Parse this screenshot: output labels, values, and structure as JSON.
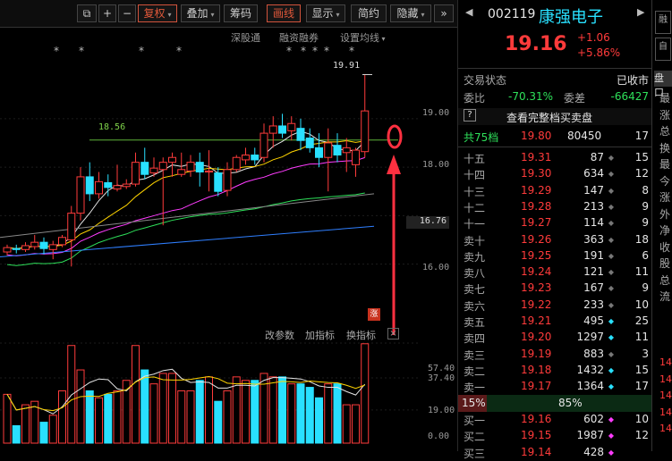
{
  "toolbar": {
    "restore_icon": "restore-window-icon",
    "zoom_in": "+",
    "zoom_out": "−",
    "adjust": "复权",
    "overlay": "叠加",
    "chips": "筹码",
    "draw": "画线",
    "display": "显示",
    "simple": "简约",
    "hide": "隐藏",
    "more": "»"
  },
  "subbar": {
    "hk": "深股通",
    "margin": "融资融券",
    "ma": "设置均线"
  },
  "chart": {
    "high_label": "19.91",
    "ref_label": "18.56",
    "prices": [
      "19.00",
      "18.00",
      "16.76",
      "16.00"
    ],
    "vol_labels": [
      "57.40",
      "37.40",
      "19.00",
      "0.00"
    ],
    "zhang_badge": "涨",
    "tabs": [
      "改参数",
      "加指标",
      "换指标"
    ],
    "close_tab": "×"
  },
  "chart_data": {
    "type": "candlestick",
    "ylim": [
      15.55,
      20.25
    ],
    "ma_colors": [
      "#e6e6e6",
      "#ffd400",
      "#ff3cff",
      "#2ee05a"
    ],
    "candles": [
      [
        16.25,
        16.4,
        16.18,
        16.34
      ],
      [
        16.32,
        16.4,
        16.22,
        16.3
      ],
      [
        16.3,
        16.45,
        16.25,
        16.38
      ],
      [
        16.36,
        16.6,
        16.3,
        16.45
      ],
      [
        16.45,
        16.55,
        16.2,
        16.32
      ],
      [
        16.3,
        16.48,
        16.1,
        16.4
      ],
      [
        16.4,
        16.6,
        16.35,
        16.55
      ],
      [
        16.5,
        17.2,
        15.95,
        17.05
      ],
      [
        17.05,
        18.0,
        16.9,
        17.8
      ],
      [
        17.8,
        18.1,
        17.3,
        17.45
      ],
      [
        17.45,
        17.9,
        17.35,
        17.7
      ],
      [
        17.68,
        17.85,
        17.4,
        17.58
      ],
      [
        17.55,
        18.05,
        17.5,
        17.62
      ],
      [
        17.6,
        17.75,
        17.55,
        17.65
      ],
      [
        17.65,
        18.3,
        17.6,
        18.1
      ],
      [
        18.1,
        18.4,
        17.75,
        17.85
      ],
      [
        17.88,
        18.2,
        17.8,
        17.98
      ],
      [
        17.95,
        18.2,
        16.8,
        18.1
      ],
      [
        18.1,
        18.3,
        17.8,
        18.2
      ],
      [
        17.85,
        18.3,
        17.8,
        17.95
      ],
      [
        17.92,
        18.25,
        17.8,
        18.1
      ],
      [
        18.1,
        18.3,
        17.6,
        17.9
      ],
      [
        17.9,
        18.35,
        17.5,
        17.92
      ],
      [
        17.88,
        18.0,
        17.4,
        17.5
      ],
      [
        17.52,
        18.1,
        17.4,
        17.95
      ],
      [
        17.95,
        18.25,
        17.9,
        18.2
      ],
      [
        18.15,
        18.4,
        18.05,
        18.25
      ],
      [
        18.25,
        18.4,
        18.05,
        18.15
      ],
      [
        18.2,
        18.9,
        18.1,
        18.7
      ],
      [
        18.7,
        19.05,
        18.4,
        18.85
      ],
      [
        18.85,
        19.1,
        18.6,
        18.7
      ],
      [
        18.75,
        19.05,
        18.55,
        18.9
      ],
      [
        18.8,
        19.0,
        18.35,
        18.55
      ],
      [
        18.6,
        18.8,
        18.3,
        18.4
      ],
      [
        18.4,
        18.7,
        18.0,
        18.2
      ],
      [
        18.2,
        18.8,
        17.5,
        18.5
      ],
      [
        18.45,
        18.7,
        18.1,
        18.25
      ],
      [
        18.3,
        18.6,
        17.9,
        18.4
      ],
      [
        18.05,
        18.4,
        17.8,
        18.35
      ],
      [
        18.32,
        19.91,
        18.2,
        19.16
      ]
    ],
    "volumes": [
      28,
      10,
      22,
      24,
      12,
      16,
      30,
      56,
      42,
      30,
      26,
      28,
      30,
      36,
      56,
      42,
      34,
      40,
      40,
      30,
      30,
      36,
      38,
      24,
      30,
      38,
      36,
      36,
      40,
      38,
      38,
      34,
      34,
      32,
      26,
      34,
      34,
      22,
      22,
      57
    ]
  },
  "quote": {
    "code": "002119",
    "name": "康强电子",
    "price": "19.16",
    "change": "+1.06",
    "pct": "+5.86%",
    "status_label": "交易状态",
    "status_value": "已收市",
    "wb_label": "委比",
    "wb_value": "-70.31%",
    "wc_label": "委差",
    "wc_value": "-66427",
    "full_book": "查看完整档买卖盘",
    "total_label": "共75档",
    "total_price": "19.80",
    "total_vol": "80450",
    "total_count": "17",
    "mid_pct": "15%",
    "mid_pct2": "85%"
  },
  "book": [
    {
      "label": "十五",
      "price": "19.31",
      "vol": "87",
      "c": "15",
      "dc": "#777"
    },
    {
      "label": "十四",
      "price": "19.30",
      "vol": "634",
      "c": "12",
      "dc": "#777"
    },
    {
      "label": "十三",
      "price": "19.29",
      "vol": "147",
      "c": "8",
      "dc": "#777"
    },
    {
      "label": "十二",
      "price": "19.28",
      "vol": "213",
      "c": "9",
      "dc": "#777"
    },
    {
      "label": "十一",
      "price": "19.27",
      "vol": "114",
      "c": "9",
      "dc": "#777"
    },
    {
      "label": "卖十",
      "price": "19.26",
      "vol": "363",
      "c": "18",
      "dc": "#777"
    },
    {
      "label": "卖九",
      "price": "19.25",
      "vol": "191",
      "c": "6",
      "dc": "#777"
    },
    {
      "label": "卖八",
      "price": "19.24",
      "vol": "121",
      "c": "11",
      "dc": "#777"
    },
    {
      "label": "卖七",
      "price": "19.23",
      "vol": "167",
      "c": "9",
      "dc": "#777"
    },
    {
      "label": "卖六",
      "price": "19.22",
      "vol": "233",
      "c": "10",
      "dc": "#777"
    },
    {
      "label": "卖五",
      "price": "19.21",
      "vol": "495",
      "c": "25",
      "dc": "#29e0ff"
    },
    {
      "label": "卖四",
      "price": "19.20",
      "vol": "1297",
      "c": "11",
      "dc": "#29e0ff"
    },
    {
      "label": "卖三",
      "price": "19.19",
      "vol": "883",
      "c": "3",
      "dc": "#777"
    },
    {
      "label": "卖二",
      "price": "19.18",
      "vol": "1432",
      "c": "15",
      "dc": "#29e0ff"
    },
    {
      "label": "卖一",
      "price": "19.17",
      "vol": "1364",
      "c": "17",
      "dc": "#29e0ff"
    }
  ],
  "bids": [
    {
      "label": "买一",
      "price": "19.16",
      "vol": "602",
      "c": "10",
      "dc": "#ff3cff"
    },
    {
      "label": "买二",
      "price": "19.15",
      "vol": "1987",
      "c": "12",
      "dc": "#ff3cff"
    },
    {
      "label": "买三",
      "price": "19.14",
      "vol": "428",
      "c": "",
      "dc": "#ff3cff"
    }
  ],
  "farright": {
    "tab": "盘口",
    "side_labels": [
      "最",
      "涨",
      "总",
      "换",
      "最",
      "今",
      "涨",
      "外",
      "净",
      "收",
      "股",
      "总",
      "流"
    ],
    "pcts": [
      "14",
      "14",
      "14",
      "14",
      "14"
    ]
  }
}
